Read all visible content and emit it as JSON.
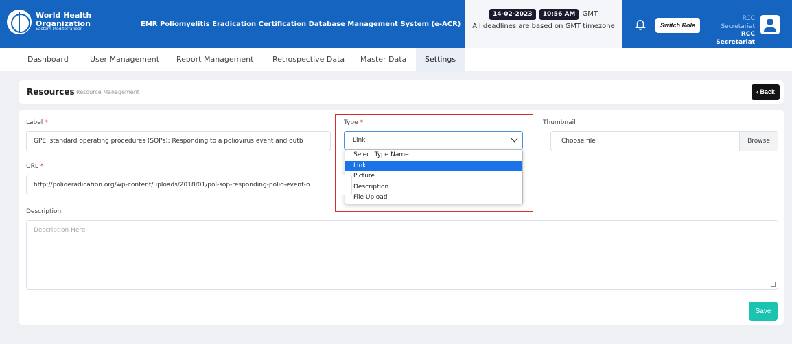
{
  "header": {
    "org_line1": "World Health",
    "org_line2": "Organization",
    "org_line3": "Eastern Mediterranean",
    "app_title": "EMR Poliomyelitis Eradication Certification Database Management System (e-ACR)",
    "date": "14-02-2023",
    "time": "10:56 AM",
    "timezone": "GMT",
    "deadline_note": "All deadlines are based on GMT timezone",
    "switch_role_label": "Switch Role",
    "role_line1": "RCC Secretariat",
    "role_line2": "RCC Secretariat"
  },
  "nav": {
    "items": [
      {
        "label": "Dashboard"
      },
      {
        "label": "User Management"
      },
      {
        "label": "Report Management"
      },
      {
        "label": "Retrospective Data"
      },
      {
        "label": "Master Data"
      },
      {
        "label": "Settings"
      }
    ],
    "active": "Settings"
  },
  "page": {
    "title": "Resources",
    "subtitle": "Resource Management",
    "back_label": "Back"
  },
  "form": {
    "label_label": "Label",
    "label_value": "GPEI standard operating procedures (SOPs): Responding to a poliovirus event and outb",
    "type_label": "Type",
    "type_value": "Link",
    "type_options": [
      "Select Type Name",
      "Link",
      "Picture",
      "Description",
      "File Upload"
    ],
    "thumbnail_label": "Thumbnail",
    "thumbnail_placeholder": "Choose file",
    "browse_label": "Browse",
    "url_label": "URL",
    "url_value": "http://polioeradication.org/wp-content/uploads/2018/01/pol-sop-responding-polio-event-o",
    "description_label": "Description",
    "description_placeholder": "Description Here",
    "required_mark": "*",
    "save_label": "Save"
  },
  "colors": {
    "header_bg": "#1565c0",
    "save_button": "#1bc4b0",
    "selected_option": "#1a73e8",
    "highlight_frame": "#d32f2f"
  }
}
